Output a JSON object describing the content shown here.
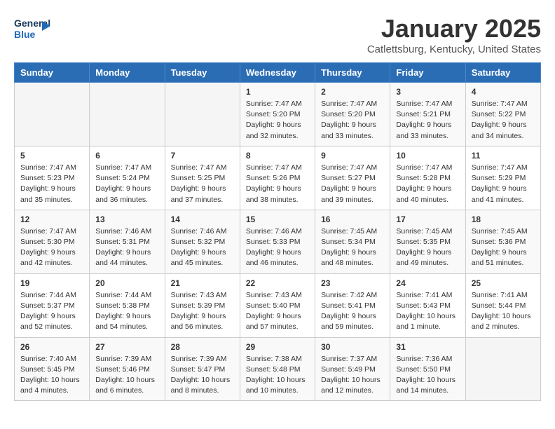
{
  "header": {
    "logo_line1": "General",
    "logo_line2": "Blue",
    "month": "January 2025",
    "location": "Catlettsburg, Kentucky, United States"
  },
  "weekdays": [
    "Sunday",
    "Monday",
    "Tuesday",
    "Wednesday",
    "Thursday",
    "Friday",
    "Saturday"
  ],
  "weeks": [
    [
      {
        "day": "",
        "info": ""
      },
      {
        "day": "",
        "info": ""
      },
      {
        "day": "",
        "info": ""
      },
      {
        "day": "1",
        "info": "Sunrise: 7:47 AM\nSunset: 5:20 PM\nDaylight: 9 hours and 32 minutes."
      },
      {
        "day": "2",
        "info": "Sunrise: 7:47 AM\nSunset: 5:20 PM\nDaylight: 9 hours and 33 minutes."
      },
      {
        "day": "3",
        "info": "Sunrise: 7:47 AM\nSunset: 5:21 PM\nDaylight: 9 hours and 33 minutes."
      },
      {
        "day": "4",
        "info": "Sunrise: 7:47 AM\nSunset: 5:22 PM\nDaylight: 9 hours and 34 minutes."
      }
    ],
    [
      {
        "day": "5",
        "info": "Sunrise: 7:47 AM\nSunset: 5:23 PM\nDaylight: 9 hours and 35 minutes."
      },
      {
        "day": "6",
        "info": "Sunrise: 7:47 AM\nSunset: 5:24 PM\nDaylight: 9 hours and 36 minutes."
      },
      {
        "day": "7",
        "info": "Sunrise: 7:47 AM\nSunset: 5:25 PM\nDaylight: 9 hours and 37 minutes."
      },
      {
        "day": "8",
        "info": "Sunrise: 7:47 AM\nSunset: 5:26 PM\nDaylight: 9 hours and 38 minutes."
      },
      {
        "day": "9",
        "info": "Sunrise: 7:47 AM\nSunset: 5:27 PM\nDaylight: 9 hours and 39 minutes."
      },
      {
        "day": "10",
        "info": "Sunrise: 7:47 AM\nSunset: 5:28 PM\nDaylight: 9 hours and 40 minutes."
      },
      {
        "day": "11",
        "info": "Sunrise: 7:47 AM\nSunset: 5:29 PM\nDaylight: 9 hours and 41 minutes."
      }
    ],
    [
      {
        "day": "12",
        "info": "Sunrise: 7:47 AM\nSunset: 5:30 PM\nDaylight: 9 hours and 42 minutes."
      },
      {
        "day": "13",
        "info": "Sunrise: 7:46 AM\nSunset: 5:31 PM\nDaylight: 9 hours and 44 minutes."
      },
      {
        "day": "14",
        "info": "Sunrise: 7:46 AM\nSunset: 5:32 PM\nDaylight: 9 hours and 45 minutes."
      },
      {
        "day": "15",
        "info": "Sunrise: 7:46 AM\nSunset: 5:33 PM\nDaylight: 9 hours and 46 minutes."
      },
      {
        "day": "16",
        "info": "Sunrise: 7:45 AM\nSunset: 5:34 PM\nDaylight: 9 hours and 48 minutes."
      },
      {
        "day": "17",
        "info": "Sunrise: 7:45 AM\nSunset: 5:35 PM\nDaylight: 9 hours and 49 minutes."
      },
      {
        "day": "18",
        "info": "Sunrise: 7:45 AM\nSunset: 5:36 PM\nDaylight: 9 hours and 51 minutes."
      }
    ],
    [
      {
        "day": "19",
        "info": "Sunrise: 7:44 AM\nSunset: 5:37 PM\nDaylight: 9 hours and 52 minutes."
      },
      {
        "day": "20",
        "info": "Sunrise: 7:44 AM\nSunset: 5:38 PM\nDaylight: 9 hours and 54 minutes."
      },
      {
        "day": "21",
        "info": "Sunrise: 7:43 AM\nSunset: 5:39 PM\nDaylight: 9 hours and 56 minutes."
      },
      {
        "day": "22",
        "info": "Sunrise: 7:43 AM\nSunset: 5:40 PM\nDaylight: 9 hours and 57 minutes."
      },
      {
        "day": "23",
        "info": "Sunrise: 7:42 AM\nSunset: 5:41 PM\nDaylight: 9 hours and 59 minutes."
      },
      {
        "day": "24",
        "info": "Sunrise: 7:41 AM\nSunset: 5:43 PM\nDaylight: 10 hours and 1 minute."
      },
      {
        "day": "25",
        "info": "Sunrise: 7:41 AM\nSunset: 5:44 PM\nDaylight: 10 hours and 2 minutes."
      }
    ],
    [
      {
        "day": "26",
        "info": "Sunrise: 7:40 AM\nSunset: 5:45 PM\nDaylight: 10 hours and 4 minutes."
      },
      {
        "day": "27",
        "info": "Sunrise: 7:39 AM\nSunset: 5:46 PM\nDaylight: 10 hours and 6 minutes."
      },
      {
        "day": "28",
        "info": "Sunrise: 7:39 AM\nSunset: 5:47 PM\nDaylight: 10 hours and 8 minutes."
      },
      {
        "day": "29",
        "info": "Sunrise: 7:38 AM\nSunset: 5:48 PM\nDaylight: 10 hours and 10 minutes."
      },
      {
        "day": "30",
        "info": "Sunrise: 7:37 AM\nSunset: 5:49 PM\nDaylight: 10 hours and 12 minutes."
      },
      {
        "day": "31",
        "info": "Sunrise: 7:36 AM\nSunset: 5:50 PM\nDaylight: 10 hours and 14 minutes."
      },
      {
        "day": "",
        "info": ""
      }
    ]
  ]
}
